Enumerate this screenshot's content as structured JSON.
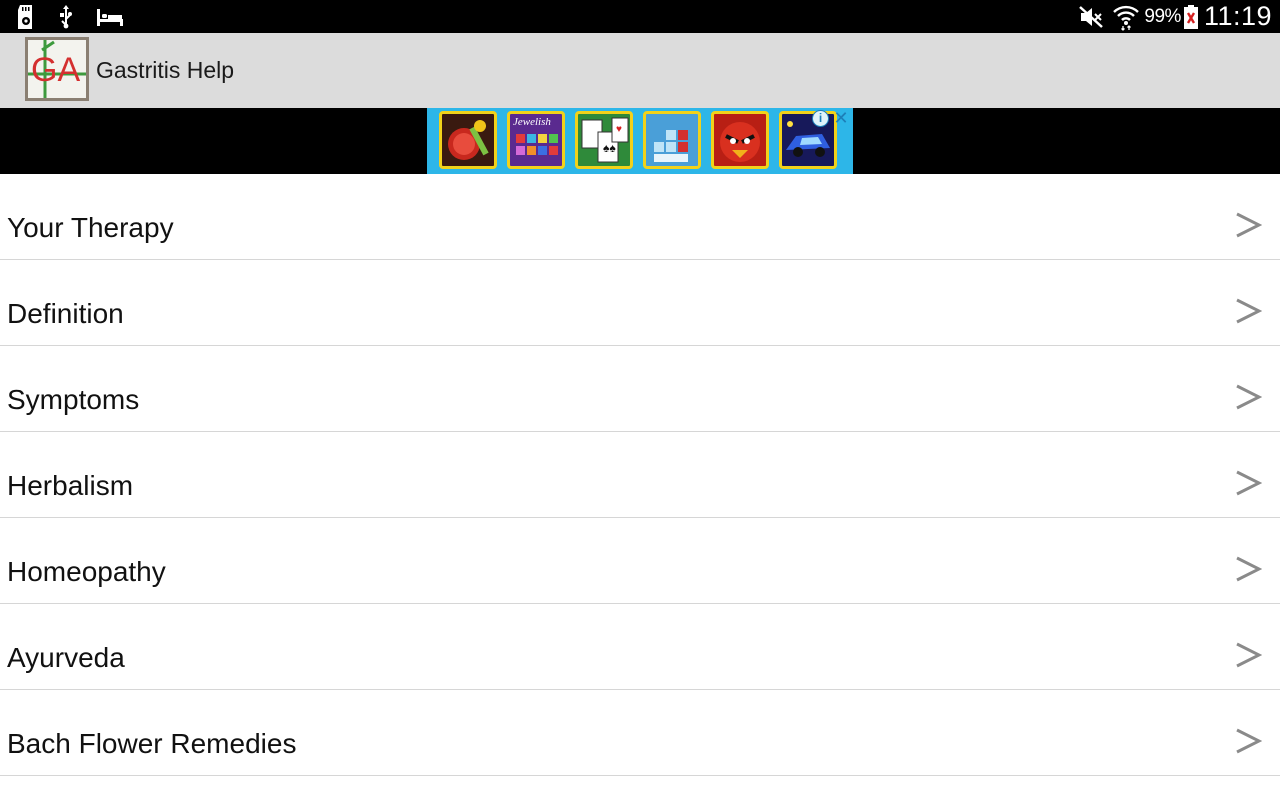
{
  "status_bar": {
    "battery_percent": "99%",
    "time": "11:19",
    "icons": [
      "sd-card-icon",
      "usb-icon",
      "bed-icon",
      "mute-icon",
      "wifi-icon",
      "battery-icon"
    ]
  },
  "app": {
    "title": "Gastritis Help",
    "logo_text": "GA"
  },
  "ad": {
    "info_label": "i",
    "close_label": "✕",
    "tiles": [
      "fruit-game",
      "jewelish-game",
      "solitaire-game",
      "blocks-game",
      "angry-bird-game",
      "racing-game"
    ],
    "tile_texts": [
      "",
      "Jewelish",
      "",
      "",
      "",
      ""
    ]
  },
  "menu": {
    "items": [
      {
        "label": "Your Therapy"
      },
      {
        "label": "Definition"
      },
      {
        "label": "Symptoms"
      },
      {
        "label": "Herbalism"
      },
      {
        "label": "Homeopathy"
      },
      {
        "label": "Ayurveda"
      },
      {
        "label": "Bach Flower Remedies"
      }
    ],
    "chevron": ">"
  },
  "colors": {
    "status_bar_bg": "#000000",
    "action_bar_bg": "#dcdcdc",
    "ad_bg": "#2db6e8",
    "divider": "#d6d6d6",
    "chevron": "#8a8a8a"
  }
}
